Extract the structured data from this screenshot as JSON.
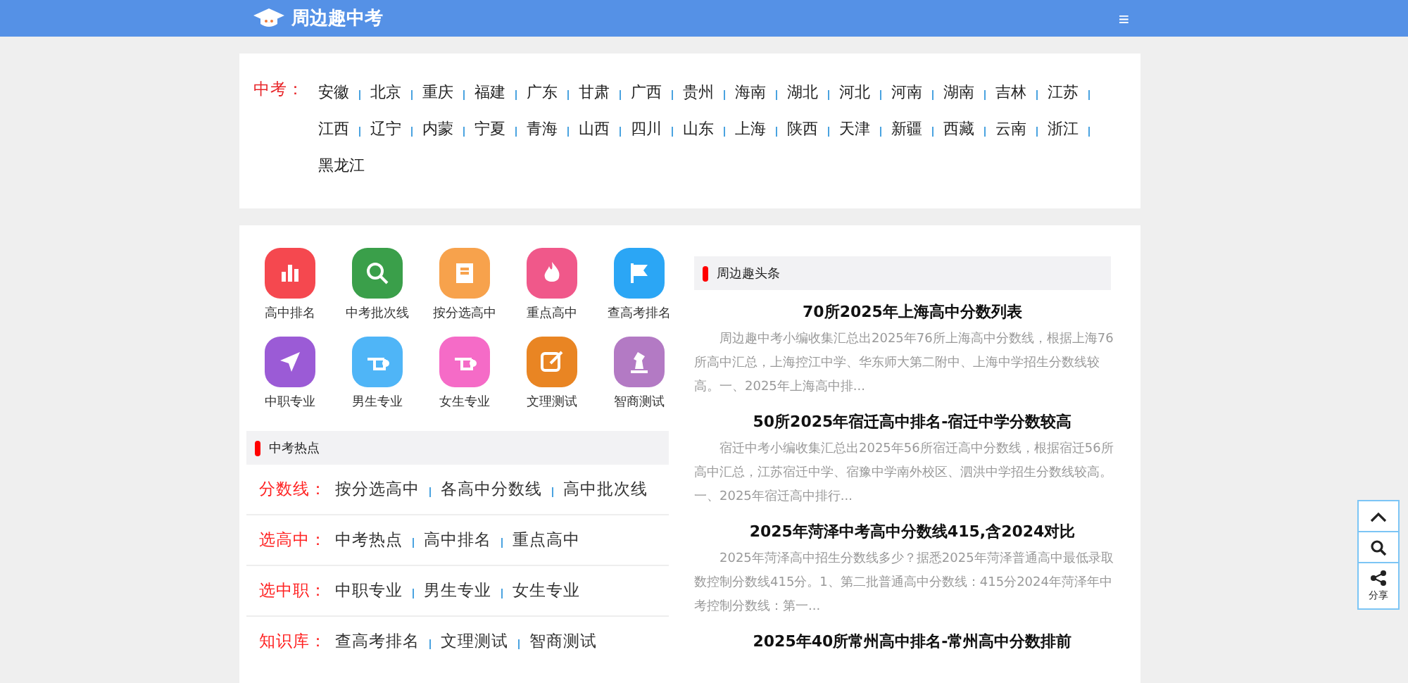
{
  "header": {
    "title": "周边趣中考",
    "menu": "≡"
  },
  "provinces": {
    "label": "中考：",
    "items": [
      "安徽",
      "北京",
      "重庆",
      "福建",
      "广东",
      "甘肃",
      "广西",
      "贵州",
      "海南",
      "湖北",
      "河北",
      "河南",
      "湖南",
      "吉林",
      "江苏",
      "江西",
      "辽宁",
      "内蒙",
      "宁夏",
      "青海",
      "山西",
      "四川",
      "山东",
      "上海",
      "陕西",
      "天津",
      "新疆",
      "西藏",
      "云南",
      "浙江",
      "黑龙江"
    ]
  },
  "shortcuts": [
    {
      "label": "高中排名",
      "kind": "chart",
      "color": "#f5484f"
    },
    {
      "label": "中考批次线",
      "kind": "search",
      "color": "#3a9f4a"
    },
    {
      "label": "按分选高中",
      "kind": "doc",
      "color": "#f7a24c"
    },
    {
      "label": "重点高中",
      "kind": "flame",
      "color": "#f0588a"
    },
    {
      "label": "查高考排名",
      "kind": "flag",
      "color": "#2ba6f5"
    },
    {
      "label": "中职专业",
      "kind": "plane",
      "color": "#9b5bd6"
    },
    {
      "label": "男生专业",
      "kind": "hand",
      "color": "#4fb5f7"
    },
    {
      "label": "女生专业",
      "kind": "hand",
      "color": "#f56bc7"
    },
    {
      "label": "文理测试",
      "kind": "edit",
      "color": "#e98523"
    },
    {
      "label": "智商测试",
      "kind": "chess",
      "color": "#b37ac4"
    }
  ],
  "hot": {
    "title": "中考热点",
    "groups": [
      {
        "label": "分数线：",
        "links": [
          "按分选高中",
          "各高中分数线",
          "高中批次线"
        ]
      },
      {
        "label": "选高中：",
        "links": [
          "中考热点",
          "高中排名",
          "重点高中"
        ]
      },
      {
        "label": "选中职：",
        "links": [
          "中职专业",
          "男生专业",
          "女生专业"
        ]
      },
      {
        "label": "知识库：",
        "links": [
          "查高考排名",
          "文理测试",
          "智商测试"
        ]
      }
    ]
  },
  "news": {
    "title": "周边趣头条",
    "items": [
      {
        "title": "70所2025年上海高中分数列表",
        "summary": "周边趣中考小编收集汇总出2025年76所上海高中分数线，根据上海76所高中汇总，上海控江中学、华东师大第二附中、上海中学招生分数线较高。一、2025年上海高中排..."
      },
      {
        "title": "50所2025年宿迁高中排名-宿迁中学分数较高",
        "summary": "宿迁中考小编收集汇总出2025年56所宿迁高中分数线，根据宿迁56所高中汇总，江苏宿迁中学、宿豫中学南外校区、泗洪中学招生分数线较高。一、2025年宿迁高中排行..."
      },
      {
        "title": "2025年菏泽中考高中分数线415,含2024对比",
        "summary": "2025年菏泽高中招生分数线多少？据悉2025年菏泽普通高中最低录取数控制分数线415分。1、第二批普通高中分数线：415分2024年菏泽年中考控制分数线：第一..."
      },
      {
        "title": "2025年40所常州高中排名-常州高中分数排前"
      }
    ]
  },
  "side_tools": {
    "share": "分享"
  }
}
